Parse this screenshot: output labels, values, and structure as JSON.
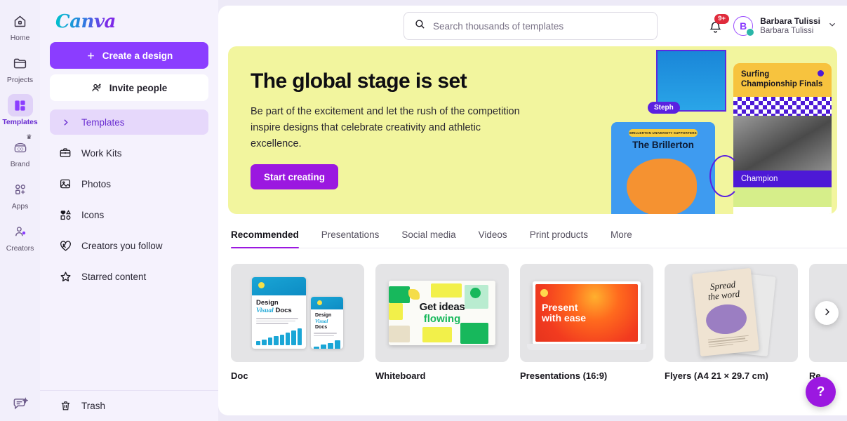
{
  "brand": {
    "logo_text": "Canva"
  },
  "rail": {
    "items": [
      {
        "label": "Home",
        "icon": "home-icon",
        "active": false,
        "badge": ""
      },
      {
        "label": "Projects",
        "icon": "folder-icon",
        "active": false,
        "badge": ""
      },
      {
        "label": "Templates",
        "icon": "templates-icon",
        "active": true,
        "badge": ""
      },
      {
        "label": "Brand",
        "icon": "brand-kit-icon",
        "active": false,
        "badge": "crown"
      },
      {
        "label": "Apps",
        "icon": "apps-grid-plus-icon",
        "active": false,
        "badge": ""
      },
      {
        "label": "Creators",
        "icon": "creators-person-icon",
        "active": false,
        "badge": ""
      }
    ],
    "bottom_icon": "feedback-sparkle-icon"
  },
  "panel": {
    "create_button": "Create a design",
    "invite_button": "Invite people",
    "nav": [
      {
        "label": "Templates",
        "icon": "chevron-right-icon",
        "active": true
      },
      {
        "label": "Work Kits",
        "icon": "briefcase-icon",
        "active": false
      },
      {
        "label": "Photos",
        "icon": "photo-icon",
        "active": false
      },
      {
        "label": "Icons",
        "icon": "shapes-icon",
        "active": false
      },
      {
        "label": "Creators you follow",
        "icon": "heart-photo-icon",
        "active": false
      },
      {
        "label": "Starred content",
        "icon": "star-icon",
        "active": false
      }
    ],
    "trash_label": "Trash",
    "trash_icon": "trash-icon"
  },
  "search": {
    "placeholder": "Search thousands of templates",
    "value": "",
    "icon": "search-icon"
  },
  "account": {
    "notification_badge": "9+",
    "bell_icon": "bell-icon",
    "avatar_initial": "B",
    "name": "Barbara Tulissi",
    "team": "Barbara Tulissi",
    "chevron_icon": "chevron-down-icon"
  },
  "hero": {
    "title": "The global stage is set",
    "body": "Be part of the excitement and let the rush of the competition inspire designs that celebrate creativity and athletic excellence.",
    "cta": "Start creating",
    "bg_color": "#f2f59e",
    "cta_color": "#9b18e0",
    "collage": {
      "steph_tag": "Steph",
      "brillerton_pill": "BRILLERTON UNIVERSITY SUPPORTERS",
      "brillerton_title": "The Brillerton",
      "surfing_title": "Surfing Championship Finals",
      "champion_label": "Champion"
    }
  },
  "tabs": [
    {
      "label": "Recommended",
      "active": true
    },
    {
      "label": "Presentations",
      "active": false
    },
    {
      "label": "Social media",
      "active": false
    },
    {
      "label": "Videos",
      "active": false
    },
    {
      "label": "Print products",
      "active": false
    },
    {
      "label": "More",
      "active": false
    }
  ],
  "cards": [
    {
      "label": "Doc",
      "art_title": "Design Visual Docs"
    },
    {
      "label": "Whiteboard",
      "art_title_a": "Get ideas",
      "art_title_b": "flowing"
    },
    {
      "label": "Presentations (16:9)",
      "art_title_a": "Present",
      "art_title_b": "with ease"
    },
    {
      "label": "Flyers (A4 21 × 29.7 cm)",
      "art_title_a": "Spread",
      "art_title_b": "the word"
    },
    {
      "label": "Re"
    }
  ],
  "controls": {
    "next_icon": "chevron-right-icon",
    "help_label": "?"
  }
}
